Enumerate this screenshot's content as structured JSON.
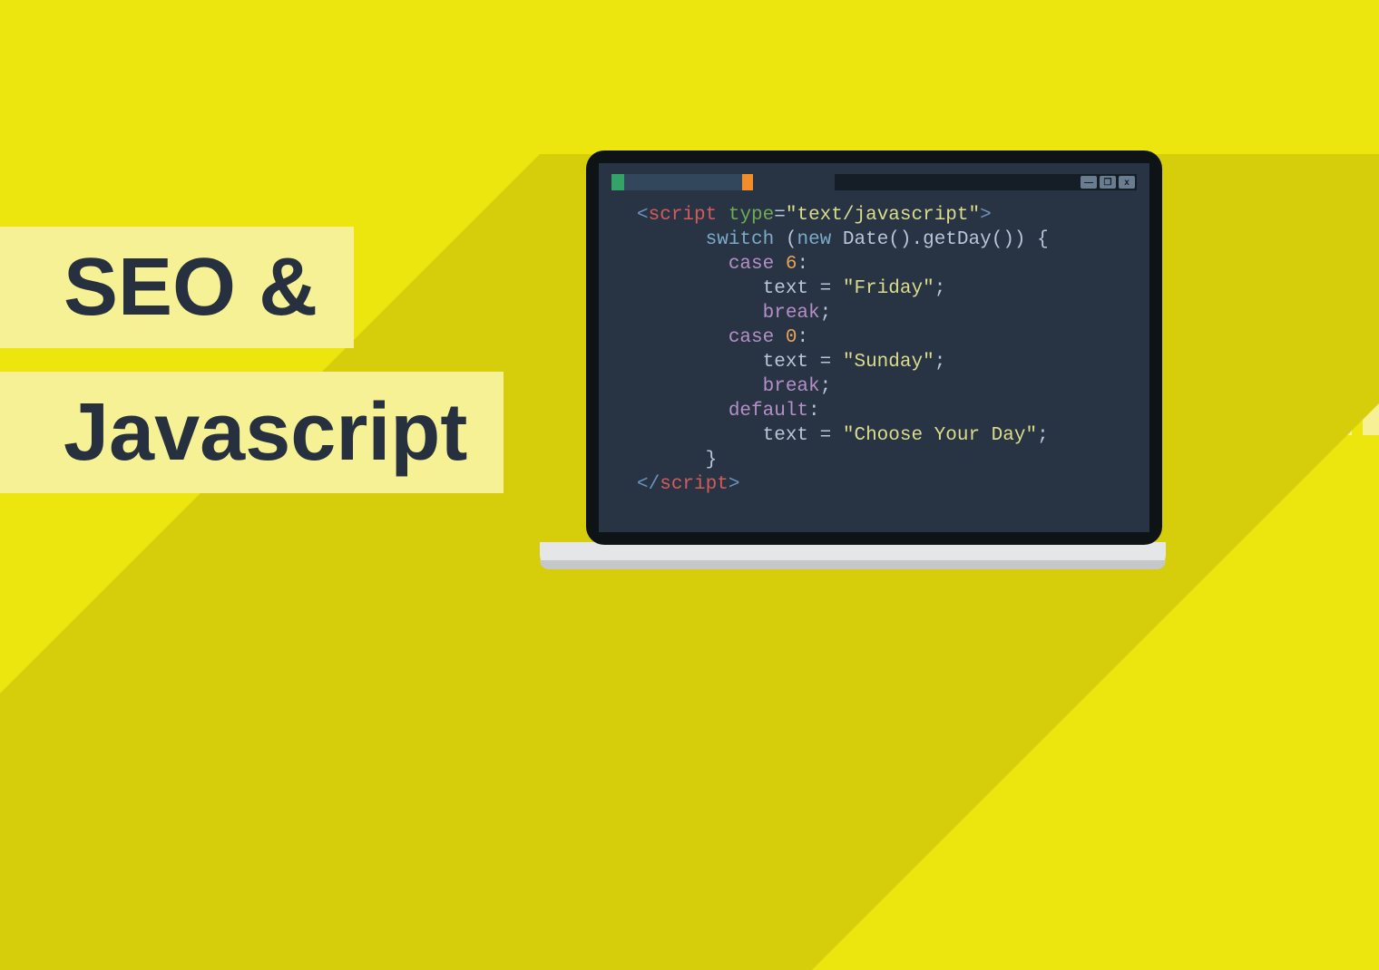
{
  "title": {
    "line1": "SEO &",
    "line2": "Javascript"
  },
  "window": {
    "btnMin": "—",
    "btnMax": "❐",
    "btnClose": "x"
  },
  "code": {
    "l01_open_ang": "<",
    "l01_script": "script",
    "l01_sp": " ",
    "l01_type": "type",
    "l01_eq": "=",
    "l01_val": "\"text/javascript\"",
    "l01_close_ang": ">",
    "l02_indent": "      ",
    "l02_switch": "switch",
    "l02_sp1": " ",
    "l02_lpar": "(",
    "l02_new": "new",
    "l02_sp2": " ",
    "l02_expr": "Date().getDay()",
    "l02_rpar": ")",
    "l02_sp3": " ",
    "l02_brace": "{",
    "l03_indent": "        ",
    "l03_case": "case",
    "l03_sp": " ",
    "l03_num": "6",
    "l03_colon": ":",
    "l04_indent": "           ",
    "l04_text": "text",
    "l04_eq": " = ",
    "l04_str": "\"Friday\"",
    "l04_semi": ";",
    "l05_indent": "           ",
    "l05_break": "break",
    "l05_semi": ";",
    "l06_indent": "        ",
    "l06_case": "case",
    "l06_sp": " ",
    "l06_num": "0",
    "l06_colon": ":",
    "l07_indent": "           ",
    "l07_text": "text",
    "l07_eq": " = ",
    "l07_str": "\"Sunday\"",
    "l07_semi": ";",
    "l08_indent": "           ",
    "l08_break": "break",
    "l08_semi": ";",
    "l09_indent": "        ",
    "l09_default": "default",
    "l09_colon": ":",
    "l10_indent": "           ",
    "l10_text": "text",
    "l10_eq": " = ",
    "l10_str": "\"Choose Your Day\"",
    "l10_semi": ";",
    "l11_indent": "      ",
    "l11_brace": "}",
    "l12_open": "</",
    "l12_script": "script",
    "l12_close": ">"
  }
}
